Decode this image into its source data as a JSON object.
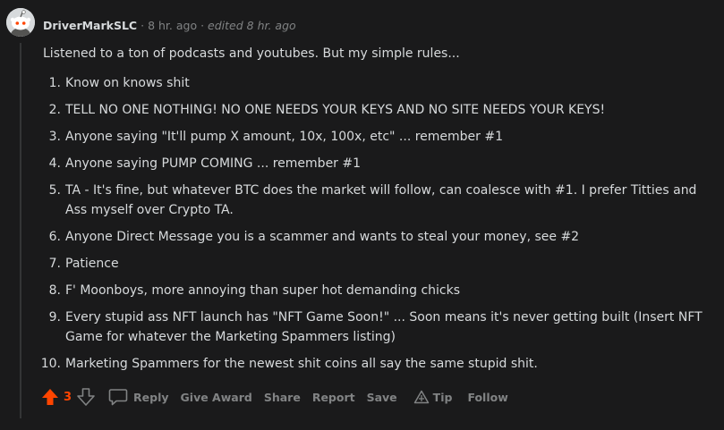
{
  "comment": {
    "author": "DriverMarkSLC",
    "separator": "·",
    "time": "8 hr. ago",
    "edited": "edited 8 hr. ago",
    "intro": "Listened to a ton of podcasts and youtubes. But my simple rules...",
    "rules": [
      {
        "num": "1.",
        "text": "Know on knows shit"
      },
      {
        "num": "2.",
        "text": "TELL NO ONE NOTHING! NO ONE NEEDS YOUR KEYS AND NO SITE NEEDS YOUR KEYS!"
      },
      {
        "num": "3.",
        "text": "Anyone saying \"It'll pump X amount, 10x, 100x, etc\" ... remember #1"
      },
      {
        "num": "4.",
        "text": "Anyone saying PUMP COMING ... remember #1"
      },
      {
        "num": "5.",
        "text": "TA - It's fine, but whatever BTC does the market will follow, can coalesce with #1. I prefer Titties and Ass myself over Crypto TA."
      },
      {
        "num": "6.",
        "text": "Anyone Direct Message you is a scammer and wants to steal your money, see #2"
      },
      {
        "num": "7.",
        "text": "Patience"
      },
      {
        "num": "8.",
        "text": "F' Moonboys, more annoying than super hot demanding chicks"
      },
      {
        "num": "9.",
        "text": "Every stupid ass NFT launch has \"NFT Game Soon!\" ... Soon means it's never getting built (Insert NFT Game for whatever the Marketing Spammers listing)"
      },
      {
        "num": "10.",
        "text": "Marketing Spammers for the newest shit coins all say the same stupid shit."
      }
    ]
  },
  "actions": {
    "vote_count": "3",
    "reply": "Reply",
    "give_award": "Give Award",
    "share": "Share",
    "report": "Report",
    "save": "Save",
    "tip": "Tip",
    "follow": "Follow"
  },
  "colors": {
    "background": "#1a1a1b",
    "text": "#d7dadc",
    "muted": "#818384",
    "upvote": "#ff4500"
  },
  "icons": {
    "avatar": "reddit-snoo-avatar",
    "upvote": "upvote-arrow-icon",
    "downvote": "downvote-arrow-icon",
    "reply": "comment-bubble-icon",
    "tip": "tip-triangle-icon"
  }
}
